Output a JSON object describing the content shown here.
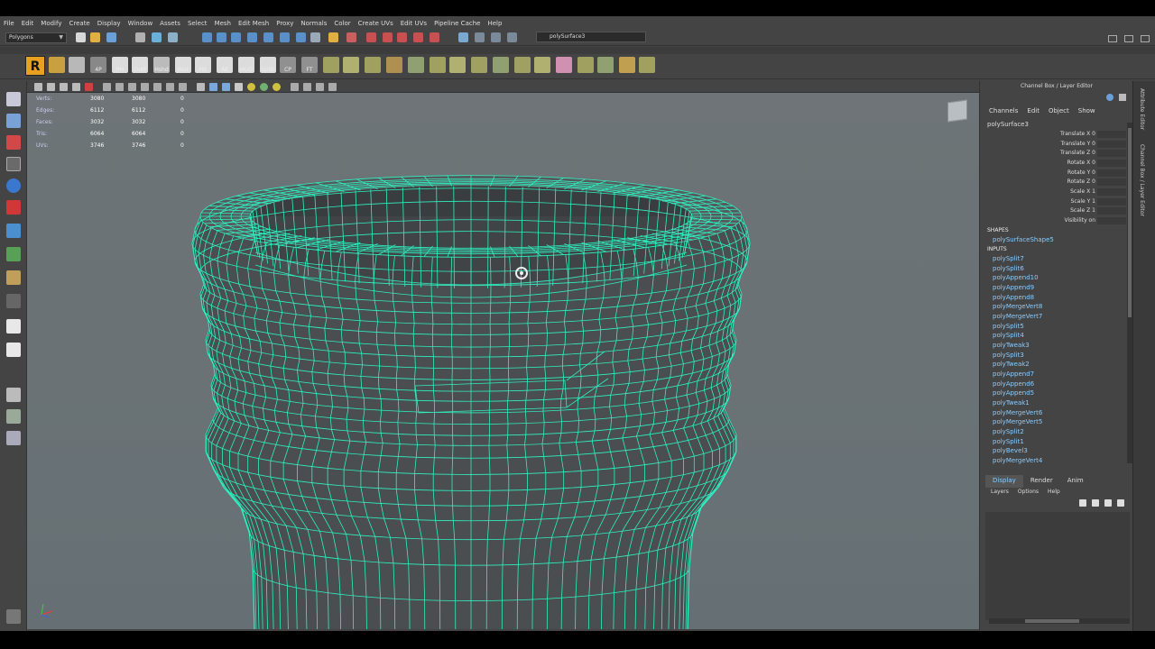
{
  "menubar": {
    "items": [
      "File",
      "Edit",
      "Modify",
      "Create",
      "Display",
      "Window",
      "Assets",
      "Select",
      "Mesh",
      "Edit Mesh",
      "Proxy",
      "Normals",
      "Color",
      "Create UVs",
      "Edit UVs",
      "Pipeline Cache",
      "Help"
    ]
  },
  "statusline": {
    "mode": "Polygons",
    "object_field": "polySurface3"
  },
  "shelf": {
    "labels": [
      "4P",
      "PH",
      "Outl",
      "Hshd",
      "Hist",
      "HS",
      "All",
      "HUO",
      "SpSh",
      "CP",
      "FT"
    ]
  },
  "hud": {
    "rows": [
      {
        "label": "Verts:",
        "v1": "3080",
        "v2": "3080",
        "v3": "0"
      },
      {
        "label": "Edges:",
        "v1": "6112",
        "v2": "6112",
        "v3": "0"
      },
      {
        "label": "Faces:",
        "v1": "3032",
        "v2": "3032",
        "v3": "0"
      },
      {
        "label": "Tris:",
        "v1": "6064",
        "v2": "6064",
        "v3": "0"
      },
      {
        "label": "UVs:",
        "v1": "3746",
        "v2": "3746",
        "v3": "0"
      }
    ]
  },
  "channel_box": {
    "title": "Channel Box / Layer Editor",
    "tabs": [
      "Channels",
      "Edit",
      "Object",
      "Show"
    ],
    "object": "polySurface3",
    "attrs": [
      "Translate X 0",
      "Translate Y 0",
      "Translate Z 0",
      "Rotate X 0",
      "Rotate Y 0",
      "Rotate Z 0",
      "Scale X 1",
      "Scale Y 1",
      "Scale Z 1",
      "Visibility on"
    ],
    "shapes_label": "SHAPES",
    "shapes": [
      "polySurfaceShape5"
    ],
    "inputs_label": "INPUTS",
    "inputs": [
      "polySplit7",
      "polySplit6",
      "polyAppend10",
      "polyAppend9",
      "polyAppend8",
      "polyMergeVert8",
      "polyMergeVert7",
      "polySplit5",
      "polySplit4",
      "polyTweak3",
      "polySplit3",
      "polyTweak2",
      "polyAppend7",
      "polyAppend6",
      "polyAppend5",
      "polyTweak1",
      "polyMergeVert6",
      "polyMergeVert5",
      "polySplit2",
      "polySplit1",
      "polyBevel3",
      "polyMergeVert4"
    ]
  },
  "layer_editor": {
    "tabs": [
      "Display",
      "Render",
      "Anim"
    ],
    "menu": [
      "Layers",
      "Options",
      "Help"
    ]
  },
  "side_tabs": [
    "Attribute Editor",
    "Channel Box / Layer Editor"
  ],
  "colors": {
    "wire": "#2ef0c0",
    "viewport_bg": "#6b7275",
    "shelf_r": "#e8a020",
    "link": "#88ccff"
  }
}
